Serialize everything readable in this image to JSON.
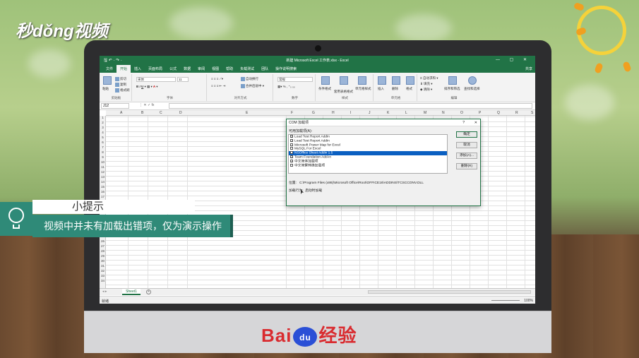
{
  "branding": {
    "corner_logo": "秒dǒng视频",
    "baidu_prefix": "Bai",
    "baidu_paw": "du",
    "baidu_suffix": "经验"
  },
  "excel": {
    "window_title": "新建 Microsoft Excel 工作表.xlsx - Excel",
    "quick_access": "🖫 ↶ · ↷ ·",
    "window_controls": "— ▢ ✕",
    "tabs": [
      "文件",
      "开始",
      "插入",
      "页面布局",
      "公式",
      "数据",
      "审阅",
      "视图",
      "帮助",
      "负载测试",
      "团队",
      "操作说明搜索"
    ],
    "active_tab": "开始",
    "share": "共享",
    "ribbon": {
      "clipboard": {
        "paste": "粘贴",
        "cut": "剪切",
        "copy": "复制",
        "format_painter": "格式刷",
        "label": "剪贴板"
      },
      "font": {
        "name": "宋体",
        "size": "11",
        "label": "字体"
      },
      "alignment": {
        "wrap": "自动换行",
        "merge": "合并后居中",
        "label": "对齐方式"
      },
      "number": {
        "format": "常规",
        "label": "数字"
      },
      "styles": {
        "cond": "条件格式",
        "table": "套用表格格式",
        "cell": "单元格样式",
        "label": "样式"
      },
      "cells": {
        "insert": "插入",
        "delete": "删除",
        "format": "格式",
        "label": "单元格"
      },
      "editing": {
        "autosum": "自动求和",
        "fill": "填充",
        "clear": "清除",
        "sort": "排序和筛选",
        "find": "查找和选择",
        "label": "编辑"
      }
    },
    "name_box": "J12",
    "fx_symbols": "⋮  ✕  ✓  fx",
    "columns": [
      "A",
      "B",
      "C",
      "D",
      "E",
      "F",
      "G",
      "H",
      "I",
      "J",
      "K",
      "L",
      "M",
      "N",
      "O",
      "P",
      "Q",
      "R",
      "S"
    ],
    "rows": [
      "1",
      "2",
      "3",
      "4",
      "5",
      "6",
      "7",
      "8",
      "9",
      "10",
      "11",
      "12",
      "13",
      "14",
      "15",
      "16",
      "17",
      "18",
      "19",
      "20",
      "21",
      "22",
      "23",
      "24",
      "25",
      "26",
      "27",
      "28",
      "29",
      "30",
      "31",
      "32",
      "33",
      "34"
    ],
    "sheet_tab": "Sheet1",
    "add_sheet": "+",
    "status_ready": "就绪",
    "zoom": "100%"
  },
  "dialog": {
    "title": "COM 加载项",
    "help": "?",
    "close": "✕",
    "available_label": "可用加载项(A):",
    "addins": [
      {
        "name": "Load Test Report Addin",
        "checked": true,
        "selected": false
      },
      {
        "name": "Load Test Report Addin",
        "checked": true,
        "selected": false
      },
      {
        "name": "Microsoft Power Map for Excel",
        "checked": false,
        "selected": false
      },
      {
        "name": "MySQL For Excel",
        "checked": false,
        "selected": false
      },
      {
        "name": "NSOffice Sheet Addin 1.5",
        "checked": false,
        "selected": true
      },
      {
        "name": "Team Foundation Add-in",
        "checked": true,
        "selected": false
      },
      {
        "name": "中文简体加载项",
        "checked": true,
        "selected": false
      },
      {
        "name": "中文简繁转换加载项",
        "checked": false,
        "selected": false
      }
    ],
    "buttons": {
      "ok": "确定",
      "cancel": "取消",
      "add": "添加(A)...",
      "remove": "删除(R)"
    },
    "location_label": "位置:",
    "location_value": "C:\\Program Files (x86)\\Microsoft Office\\Root\\OFFICE16\\ADDINS\\TCSCCONV.DLL",
    "behavior_label": "加载行为:",
    "behavior_value": "启动时加载"
  },
  "tip": {
    "heading": "小提示",
    "body": "视频中并未有加载出错项，仅为演示操作"
  }
}
